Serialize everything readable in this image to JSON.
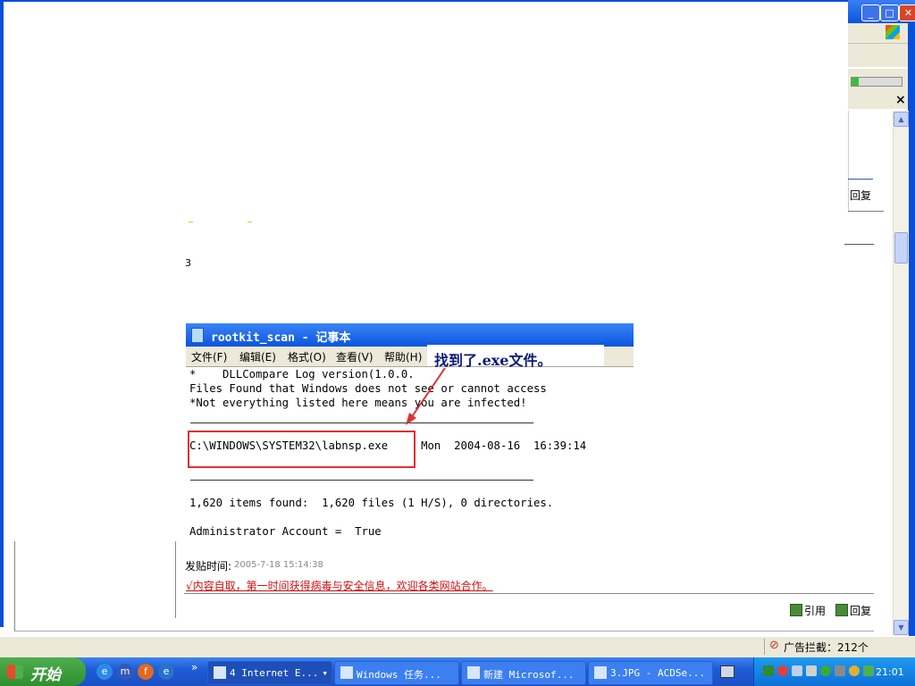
{
  "window": {
    "title_buttons": {
      "minimize": "_",
      "maximize": "□",
      "close": "✕"
    },
    "close_x": "×",
    "reply_top": "回复"
  },
  "page": {
    "number": "3",
    "post_time_label": "发贴时间:",
    "post_time_value": "2005-7-18 15:14:38",
    "slogan": "√内容自取，第一时间获得病毒与安全信息，欢迎各类网站合作。",
    "quote_label": "引用",
    "reply_label": "回复"
  },
  "notepad": {
    "title": "rootkit_scan - 记事本",
    "menu": [
      "文件(F)",
      "编辑(E)",
      "格式(O)",
      "查看(V)",
      "帮助(H)"
    ],
    "lines": {
      "l1": "*    DLLCompare Log version(1.0.0.",
      "l2": "Files Found that Windows does not see or cannot access",
      "l3": "*Not everything listed here means you are infected!",
      "l4": "C:\\WINDOWS\\SYSTEM32\\labnsp.exe     Mon  2004-08-16  16:39:14",
      "l5": "1,620 items found:  1,620 files (1 H/S), 0 directories.",
      "l6": "Administrator Account =  True"
    },
    "annotation": "找到了.exe文件。",
    "annotation_color": "#0a1a7a",
    "highlight_color": "#e03030"
  },
  "statusbar": {
    "popup_blocked": "广告拦截：212个"
  },
  "taskbar": {
    "start_label": "开始",
    "quicklaunch_more": "»",
    "tasks": [
      {
        "label": "4 Internet E..."
      },
      {
        "label": "Windows 任务..."
      },
      {
        "label": "新建 Microsof..."
      },
      {
        "label": "3.JPG - ACDSe..."
      }
    ],
    "clock": "21:01"
  }
}
